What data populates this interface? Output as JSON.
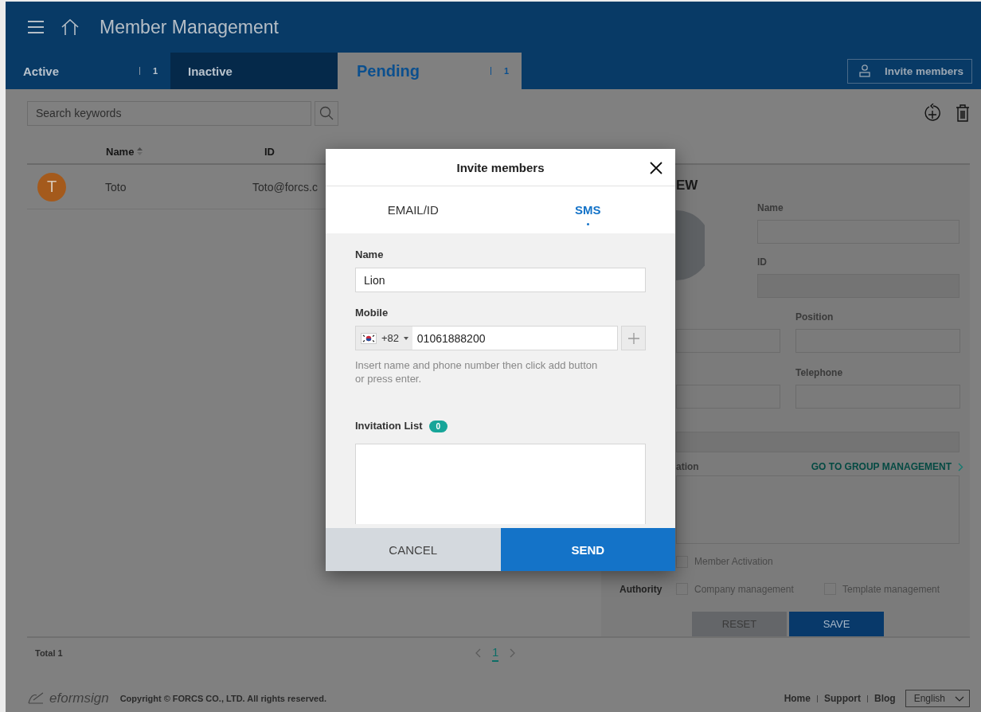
{
  "header": {
    "title": "Member Management"
  },
  "tabs": [
    {
      "label": "Active",
      "count": "1",
      "selected": false
    },
    {
      "label": "Inactive",
      "selected": false
    },
    {
      "label": "Pending",
      "count": "1",
      "selected": true
    }
  ],
  "invite_button": "Invite members",
  "search": {
    "placeholder": "Search keywords"
  },
  "table": {
    "columns": [
      "Name",
      "ID"
    ],
    "rows": [
      {
        "initial": "T",
        "name": "Toto",
        "id": "Toto@forcs.c",
        "color": "#a45a1c"
      }
    ]
  },
  "detail": {
    "title": "EW",
    "name_label": "Name",
    "id_label": "ID",
    "position_label": "Position",
    "telephone_label": "Telephone",
    "group_label": "ation",
    "group_link": "GO TO GROUP MANAGEMENT",
    "activation": [
      {
        "label": "Member Activation",
        "checked": false
      }
    ],
    "authority_label": "Authority",
    "authority": [
      {
        "label": "Company management",
        "checked": false
      },
      {
        "label": "Template management",
        "checked": false
      }
    ],
    "reset": "RESET",
    "save": "SAVE"
  },
  "footer": {
    "total": "Total 1",
    "pages": [
      {
        "label": "1",
        "selected": true
      }
    ],
    "logo": "eformsign",
    "copyright": "Copyright © FORCS CO., LTD. All rights reserved.",
    "links": [
      "Home",
      "Support",
      "Blog"
    ],
    "language": "English"
  },
  "modal": {
    "title": "Invite members",
    "tabs": [
      {
        "label": "EMAIL/ID",
        "selected": false
      },
      {
        "label": "SMS",
        "selected": true
      }
    ],
    "name_label": "Name",
    "name_value": "Lion",
    "mobile_label": "Mobile",
    "country_code": "+82",
    "phone_value": "01061888200",
    "hint": "Insert name and phone number then click add button or press enter.",
    "list_label": "Invitation List",
    "list_count": "0",
    "cancel": "CANCEL",
    "send": "SEND"
  }
}
